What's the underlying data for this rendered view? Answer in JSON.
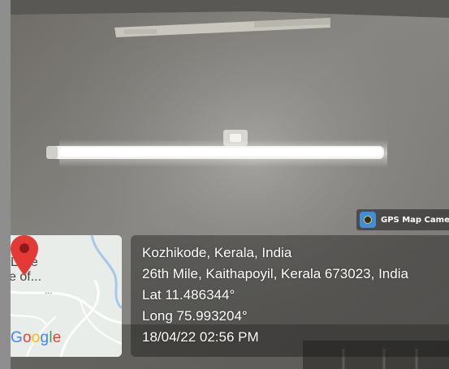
{
  "gps_badge": {
    "label": "GPS Map Camer",
    "icon": "gps-map-camera-icon",
    "icon_color": "#3d8fdd"
  },
  "map": {
    "place_line1": "Little",
    "place_line2": "e of...",
    "dots": "...",
    "logo_text": "Google",
    "pin_color": "#e53935"
  },
  "location": {
    "city": "Kozhikode, Kerala, India",
    "address": "26th Mile, Kaithapoyil, Kerala 673023, India",
    "latitude": "Lat 11.486344°",
    "longitude": "Long 75.993204°",
    "datetime": "18/04/22 02:56 PM"
  }
}
